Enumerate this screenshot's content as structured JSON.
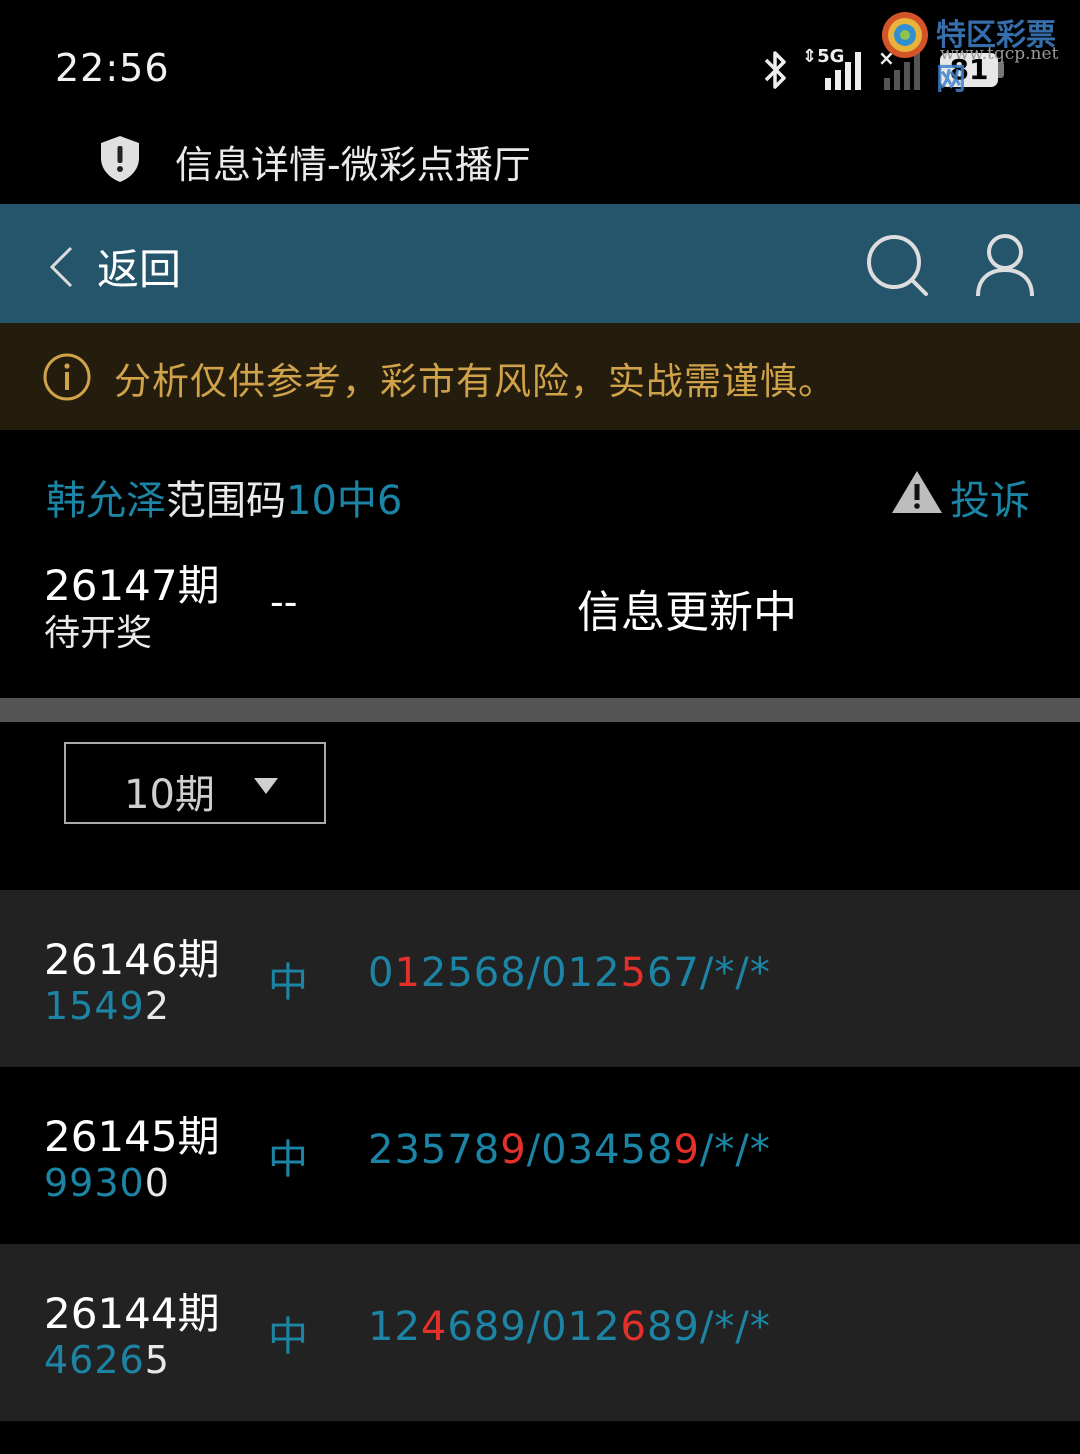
{
  "status_bar": {
    "time": "22:56",
    "network": "5G",
    "sim2": "×",
    "battery": "81"
  },
  "watermark": {
    "name": "特区彩票网",
    "url": "www.tqcp.net"
  },
  "page_title": "信息详情-微彩点播厅",
  "nav": {
    "back_label": "返回",
    "icons": [
      "chevron-left-icon",
      "search-icon",
      "user-icon"
    ]
  },
  "banner": {
    "text": "分析仅供参考，彩市有风险，实战需谨慎。",
    "color": "#d0a24a"
  },
  "info": {
    "title_author": "韩允泽",
    "title_type": "范围码",
    "title_rule": "10中6",
    "complain_label": "投诉"
  },
  "current": {
    "period": "26147期",
    "status": "待开奖",
    "result": "--",
    "update_text": "信息更新中"
  },
  "filter": {
    "selected": "10期"
  },
  "colors": {
    "accent": "#1c84a5",
    "navbar": "#24556a",
    "hit": "#e4302a"
  },
  "rows": [
    {
      "period": "26146期",
      "result_parts": [
        {
          "text": "1549",
          "hit": false
        },
        {
          "text": "2",
          "hit": true
        }
      ],
      "status": "中",
      "pred_parts": [
        {
          "text": "0",
          "hit": false
        },
        {
          "text": "1",
          "hit": true
        },
        {
          "text": "2568/012",
          "hit": false
        },
        {
          "text": "5",
          "hit": true
        },
        {
          "text": "67/*/*",
          "hit": false
        }
      ]
    },
    {
      "period": "26145期",
      "result_parts": [
        {
          "text": "9930",
          "hit": false
        },
        {
          "text": "0",
          "hit": true
        }
      ],
      "status": "中",
      "pred_parts": [
        {
          "text": "23578",
          "hit": false
        },
        {
          "text": "9",
          "hit": true
        },
        {
          "text": "/03458",
          "hit": false
        },
        {
          "text": "9",
          "hit": true
        },
        {
          "text": "/*/*",
          "hit": false
        }
      ]
    },
    {
      "period": "26144期",
      "result_parts": [
        {
          "text": "4626",
          "hit": false
        },
        {
          "text": "5",
          "hit": true
        }
      ],
      "status": "中",
      "pred_parts": [
        {
          "text": "12",
          "hit": false
        },
        {
          "text": "4",
          "hit": true
        },
        {
          "text": "689/012",
          "hit": false
        },
        {
          "text": "6",
          "hit": true
        },
        {
          "text": "89/*/*",
          "hit": false
        }
      ]
    }
  ]
}
